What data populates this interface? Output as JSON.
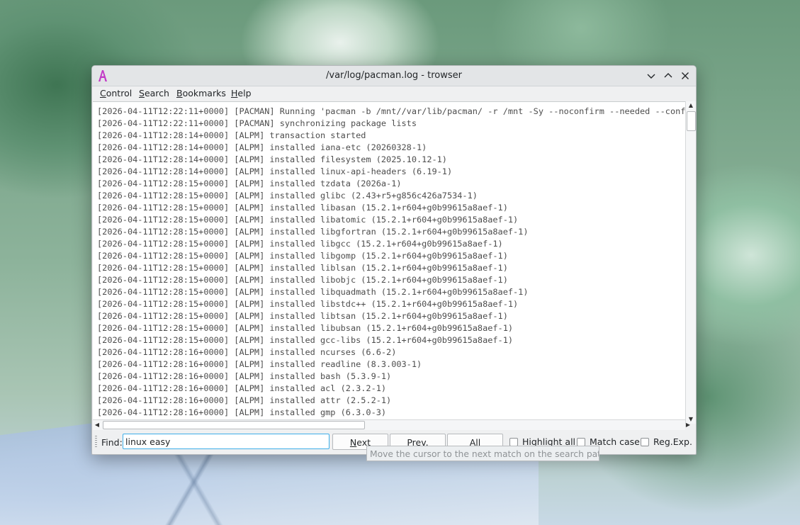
{
  "window": {
    "title": "/var/log/pacman.log - trowser",
    "accent_color": "#3daee9"
  },
  "menu": {
    "items": [
      {
        "first": "C",
        "rest": "ontrol"
      },
      {
        "first": "S",
        "rest": "earch"
      },
      {
        "first": "B",
        "rest": "ookmarks"
      },
      {
        "first": "H",
        "rest": "elp"
      }
    ]
  },
  "log_lines": [
    "[2026-04-11T12:22:11+0000] [PACMAN] Running 'pacman -b /mnt//var/lib/pacman/ -r /mnt -Sy --noconfirm --needed --conf",
    "[2026-04-11T12:22:11+0000] [PACMAN] synchronizing package lists",
    "[2026-04-11T12:28:14+0000] [ALPM] transaction started",
    "[2026-04-11T12:28:14+0000] [ALPM] installed iana-etc (20260328-1)",
    "[2026-04-11T12:28:14+0000] [ALPM] installed filesystem (2025.10.12-1)",
    "[2026-04-11T12:28:14+0000] [ALPM] installed linux-api-headers (6.19-1)",
    "[2026-04-11T12:28:15+0000] [ALPM] installed tzdata (2026a-1)",
    "[2026-04-11T12:28:15+0000] [ALPM] installed glibc (2.43+r5+g856c426a7534-1)",
    "[2026-04-11T12:28:15+0000] [ALPM] installed libasan (15.2.1+r604+g0b99615a8aef-1)",
    "[2026-04-11T12:28:15+0000] [ALPM] installed libatomic (15.2.1+r604+g0b99615a8aef-1)",
    "[2026-04-11T12:28:15+0000] [ALPM] installed libgfortran (15.2.1+r604+g0b99615a8aef-1)",
    "[2026-04-11T12:28:15+0000] [ALPM] installed libgcc (15.2.1+r604+g0b99615a8aef-1)",
    "[2026-04-11T12:28:15+0000] [ALPM] installed libgomp (15.2.1+r604+g0b99615a8aef-1)",
    "[2026-04-11T12:28:15+0000] [ALPM] installed liblsan (15.2.1+r604+g0b99615a8aef-1)",
    "[2026-04-11T12:28:15+0000] [ALPM] installed libobjc (15.2.1+r604+g0b99615a8aef-1)",
    "[2026-04-11T12:28:15+0000] [ALPM] installed libquadmath (15.2.1+r604+g0b99615a8aef-1)",
    "[2026-04-11T12:28:15+0000] [ALPM] installed libstdc++ (15.2.1+r604+g0b99615a8aef-1)",
    "[2026-04-11T12:28:15+0000] [ALPM] installed libtsan (15.2.1+r604+g0b99615a8aef-1)",
    "[2026-04-11T12:28:15+0000] [ALPM] installed libubsan (15.2.1+r604+g0b99615a8aef-1)",
    "[2026-04-11T12:28:15+0000] [ALPM] installed gcc-libs (15.2.1+r604+g0b99615a8aef-1)",
    "[2026-04-11T12:28:16+0000] [ALPM] installed ncurses (6.6-2)",
    "[2026-04-11T12:28:16+0000] [ALPM] installed readline (8.3.003-1)",
    "[2026-04-11T12:28:16+0000] [ALPM] installed bash (5.3.9-1)",
    "[2026-04-11T12:28:16+0000] [ALPM] installed acl (2.3.2-1)",
    "[2026-04-11T12:28:16+0000] [ALPM] installed attr (2.5.2-1)",
    "[2026-04-11T12:28:16+0000] [ALPM] installed gmp (6.3.0-3)"
  ],
  "find": {
    "label": "Find:",
    "value": "linux easy",
    "next": {
      "first": "N",
      "rest": "ext"
    },
    "prev": {
      "first": "P",
      "rest": "rev."
    },
    "all": {
      "first": "A",
      "rest": "ll"
    },
    "highlight_all": "Highlight all",
    "match_case": "Match case",
    "regexp": "Reg.Exp."
  },
  "tooltip": "Move the cursor to the next match on the search pattern."
}
